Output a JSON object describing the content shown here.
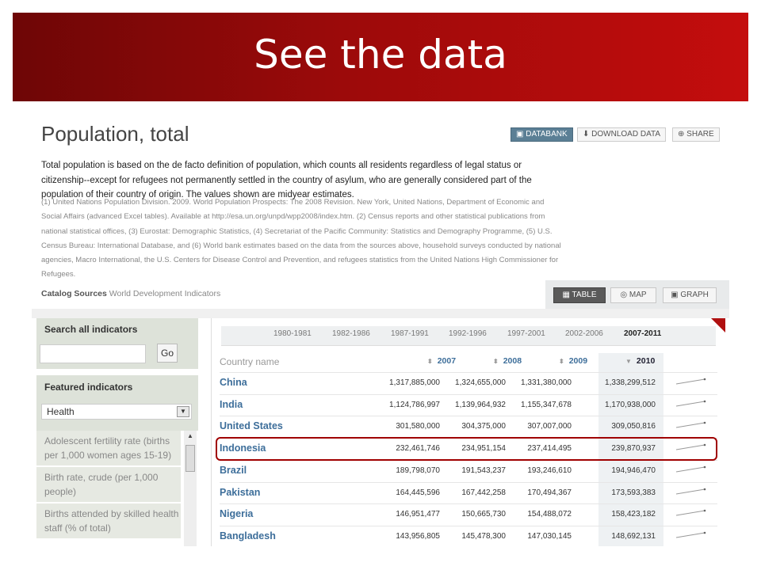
{
  "slide": {
    "title": "See the data"
  },
  "page": {
    "title": "Population, total",
    "buttons": {
      "databank": "DATABANK",
      "download": "DOWNLOAD DATA",
      "share": "SHARE"
    },
    "description": "Total population is based on the de facto definition of population, which counts all residents regardless of legal status or citizenship--except for refugees not permanently settled in the country of asylum, who are generally considered part of the population of their country of origin. The values shown are midyear estimates.",
    "notes": "(1) United Nations Population Division. 2009. World Population Prospects: The 2008 Revision. New York, United Nations, Department of Economic and Social Affairs (advanced Excel tables). Available at http://esa.un.org/unpd/wpp2008/index.htm. (2) Census reports and other statistical publications from national statistical offices, (3) Eurostat: Demographic Statistics, (4) Secretariat of the Pacific Community: Statistics and Demography Programme, (5) U.S. Census Bureau: International Database, and (6) World bank estimates based on the data from the sources above, household surveys conducted by national agencies, Macro International, the U.S. Centers for Disease Control and Prevention, and refugees statistics from the United Nations High Commissioner for Refugees.",
    "catalog_label": "Catalog Sources",
    "catalog_value": "World Development Indicators",
    "views": {
      "table": "TABLE",
      "map": "MAP",
      "graph": "GRAPH"
    }
  },
  "sidebar": {
    "search_label": "Search all indicators",
    "search_value": "",
    "go_label": "Go",
    "featured_label": "Featured indicators",
    "topic_selected": "Health",
    "items": [
      "Adolescent fertility rate (births per 1,000 women ages 15-19)",
      "Birth rate, crude (per 1,000 people)",
      "Births attended by skilled health staff (% of total)"
    ]
  },
  "table": {
    "periods": [
      "1980-1981",
      "1982-1986",
      "1987-1991",
      "1992-1996",
      "1997-2001",
      "2002-2006",
      "2007-2011"
    ],
    "selected_period": "2007-2011",
    "column_name": "Country name",
    "years": [
      "2007",
      "2008",
      "2009",
      "2010"
    ],
    "rows": [
      {
        "country": "China",
        "values": [
          "1,317,885,000",
          "1,324,655,000",
          "1,331,380,000",
          "1,338,299,512"
        ]
      },
      {
        "country": "India",
        "values": [
          "1,124,786,997",
          "1,139,964,932",
          "1,155,347,678",
          "1,170,938,000"
        ]
      },
      {
        "country": "United States",
        "values": [
          "301,580,000",
          "304,375,000",
          "307,007,000",
          "309,050,816"
        ]
      },
      {
        "country": "Indonesia",
        "values": [
          "232,461,746",
          "234,951,154",
          "237,414,495",
          "239,870,937"
        ]
      },
      {
        "country": "Brazil",
        "values": [
          "189,798,070",
          "191,543,237",
          "193,246,610",
          "194,946,470"
        ]
      },
      {
        "country": "Pakistan",
        "values": [
          "164,445,596",
          "167,442,258",
          "170,494,367",
          "173,593,383"
        ]
      },
      {
        "country": "Nigeria",
        "values": [
          "146,951,477",
          "150,665,730",
          "154,488,072",
          "158,423,182"
        ]
      },
      {
        "country": "Bangladesh",
        "values": [
          "143,956,805",
          "145,478,300",
          "147,030,145",
          "148,692,131"
        ]
      }
    ],
    "highlighted_country": "Indonesia"
  },
  "colors": {
    "banner_dark": "#6e0606",
    "banner_light": "#c40d0d",
    "link": "#3d6e9a",
    "highlight_border": "#a00000"
  }
}
